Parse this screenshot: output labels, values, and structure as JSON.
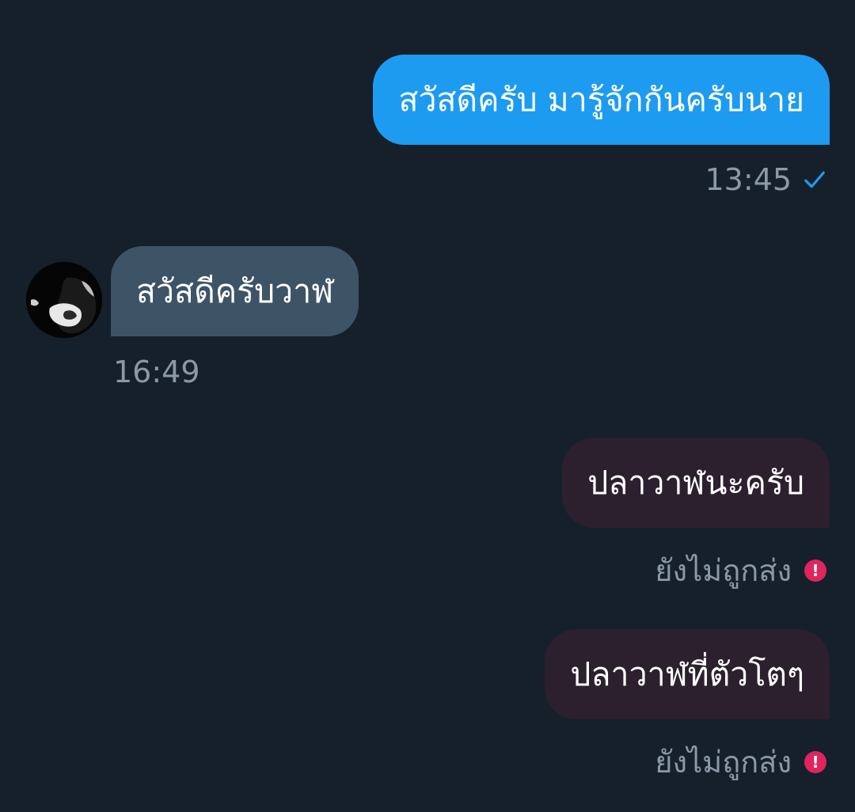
{
  "colors": {
    "background": "#15202b",
    "sent_bubble": "#1d9bf0",
    "received_bubble": "#3d5466",
    "failed_bubble": "#2c1f2e",
    "meta_text": "#8b98a5",
    "check": "#1d9bf0",
    "error": "#e0245e"
  },
  "messages": [
    {
      "direction": "sent",
      "text": "สวัสดีครับ มารู้จักกันครับนาย",
      "meta": "13:45",
      "status_icon": "check-icon"
    },
    {
      "direction": "received",
      "text": "สวัสดีครับวาฬ",
      "meta": "16:49",
      "avatar": "avatar-image"
    },
    {
      "direction": "sent",
      "text": "ปลาวาฬนะครับ",
      "meta": "ยังไม่ถูกส่ง",
      "status_icon": "error-icon"
    },
    {
      "direction": "sent",
      "text": "ปลาวาฬที่ตัวโตๆ",
      "meta": "ยังไม่ถูกส่ง",
      "status_icon": "error-icon"
    }
  ],
  "error_glyph": "!"
}
